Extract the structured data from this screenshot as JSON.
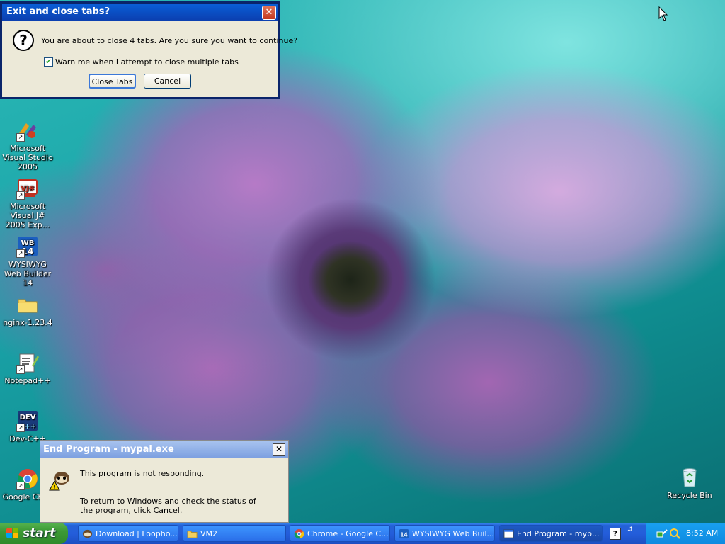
{
  "exit_dialog": {
    "title": "Exit and close tabs?",
    "message": "You are about to close 4 tabs. Are you sure you want to continue?",
    "checkbox_label": "Warn me when I attempt to close multiple tabs",
    "checkbox_checked": true,
    "close_tabs_label": "Close Tabs",
    "cancel_label": "Cancel"
  },
  "end_program_dialog": {
    "title": "End Program - mypal.exe",
    "line1": "This program is not responding.",
    "line2": "To return to Windows and check the status of the program, click Cancel."
  },
  "desktop_icons": [
    {
      "label": "Microsoft Visual Studio 2005"
    },
    {
      "label": "Microsoft Visual J# 2005 Exp..."
    },
    {
      "label": "WYSIWYG Web Builder 14"
    },
    {
      "label": "nginx-1.23.4"
    },
    {
      "label": "Notepad++"
    },
    {
      "label": "Dev-C++"
    },
    {
      "label": "Google Chr..."
    },
    {
      "label": "Recycle Bin"
    }
  ],
  "taskbar": {
    "start_label": "start",
    "items": [
      {
        "label": "Download | Loopho..."
      },
      {
        "label": "VM2"
      },
      {
        "label": "Chrome - Google C..."
      },
      {
        "label": "WYSIWYG Web Buil..."
      },
      {
        "label": "End Program - myp..."
      }
    ],
    "clock": "8:52 AM"
  },
  "colors": {
    "title_active": "#0b3fb0",
    "taskbar_blue": "#245edb",
    "start_green": "#3c9a35",
    "dialog_face": "#ece9d8"
  }
}
